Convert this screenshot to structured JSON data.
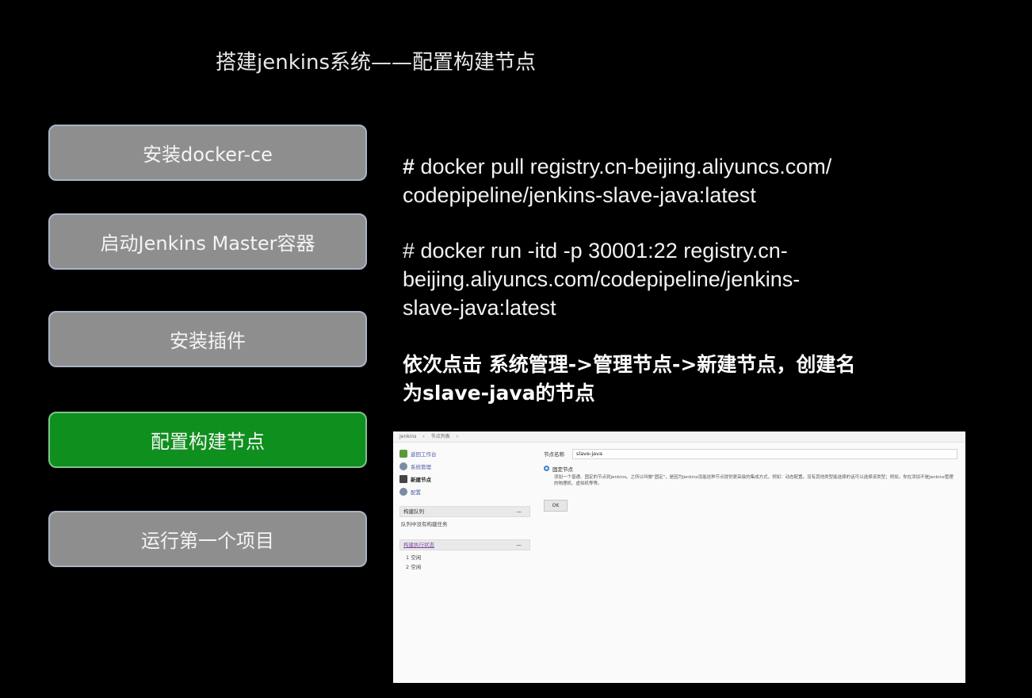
{
  "slide": {
    "title": "搭建jenkins系统——配置构建节点"
  },
  "steps": [
    {
      "label": "安装docker-ce",
      "active": false
    },
    {
      "label": "启动Jenkins Master容器",
      "active": false
    },
    {
      "label": "安装插件",
      "active": false
    },
    {
      "label": "配置构建节点",
      "active": true
    },
    {
      "label": "运行第一个项目",
      "active": false
    }
  ],
  "commands": {
    "pull": {
      "hash": "#",
      "lines": [
        " docker pull registry.cn-beijing.aliyuncs.com/",
        "codepipeline/jenkins-slave-java:latest"
      ]
    },
    "run": {
      "lines": [
        "# docker run -itd -p 30001:22 registry.cn-",
        "beijing.aliyuncs.com/codepipeline/jenkins-",
        "slave-java:latest"
      ]
    }
  },
  "instruction": {
    "lines": [
      "依次点击 系统管理->管理节点->新建节点，创建名",
      "为slave-java的节点"
    ]
  },
  "jenkins": {
    "breadcrumb": [
      "Jenkins",
      "›",
      "节点列表",
      "›"
    ],
    "tasks": [
      {
        "label": "返回工作台",
        "icon": "home-icon"
      },
      {
        "label": "系统管理",
        "icon": "gear-icon"
      },
      {
        "label": "新建节点",
        "icon": "document-icon"
      },
      {
        "label": "配置",
        "icon": "gear-icon"
      }
    ],
    "build_queue": {
      "title": "构建队列",
      "collapse": "—",
      "empty_text": "队列中没有构建任务"
    },
    "executor_status": {
      "title": "构建执行状态",
      "collapse": "—",
      "executors": [
        "1 空闲",
        "2 空闲"
      ]
    },
    "form": {
      "node_name_label": "节点名称",
      "node_name_value": "slave-java",
      "option_label": "固定节点",
      "option_desc": "添加一个普通、固定的节点到Jenkins。之所以叫做\"固定\"，是因为Jenkins没能这种节点提供更高级的集成方式，例如：动态配置。没有其他类型能选择的话可以选择该类型；例如，你在添加不是Jenkins管理的物理机、虚拟机等等。",
      "ok_label": "OK"
    }
  }
}
